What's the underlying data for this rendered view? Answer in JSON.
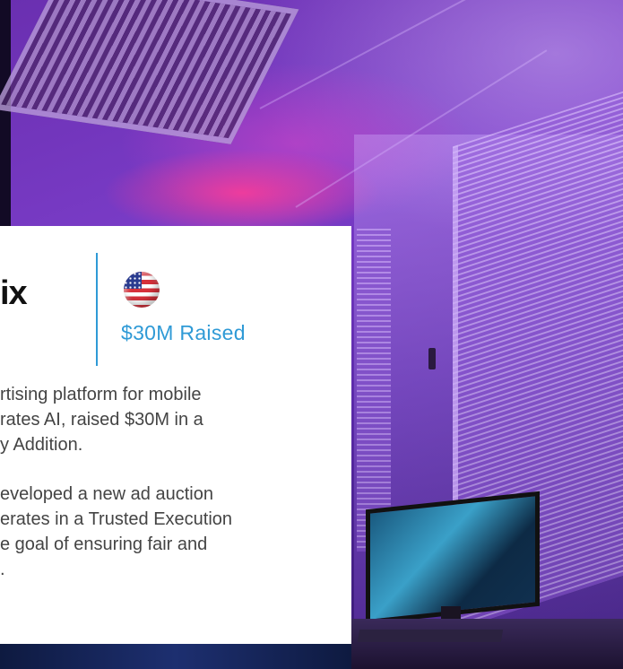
{
  "card": {
    "logo_fragment": "ix",
    "funding_badge": "$30M Raised",
    "flag_icon": "us-flag-icon",
    "paragraph1_lines": [
      "rtising platform for mobile",
      "rates AI, raised $30M in a",
      "y Addition."
    ],
    "paragraph2_lines": [
      "eveloped a new ad auction",
      "erates in a Trusted Execution",
      "e goal of ensuring fair and",
      "."
    ]
  },
  "colors": {
    "accent": "#2f9ad6",
    "body_text": "#444444",
    "card_bg": "#ffffff",
    "background_purple": "#6a2fb0"
  }
}
